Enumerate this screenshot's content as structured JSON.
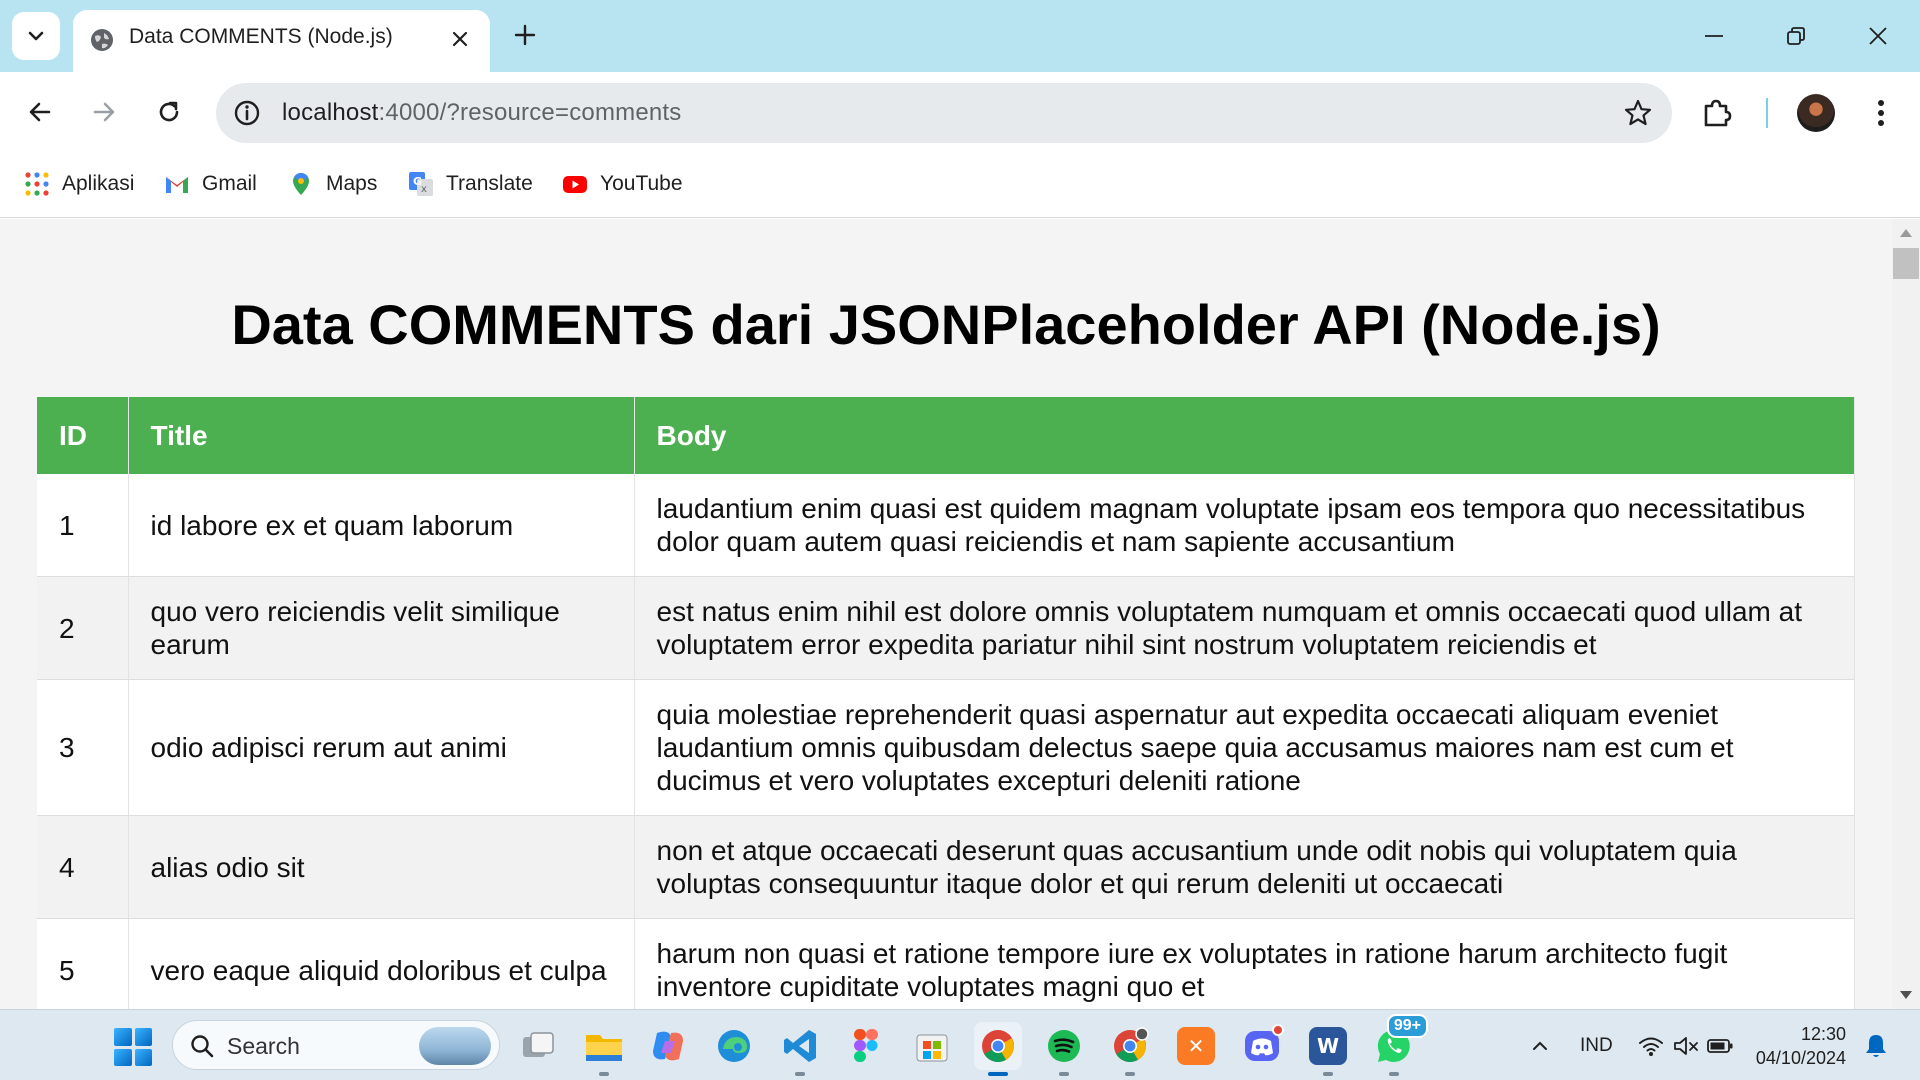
{
  "browser": {
    "tab": {
      "title": "Data COMMENTS (Node.js)"
    },
    "address": {
      "host": "localhost",
      "rest": ":4000/?resource=comments"
    },
    "bookmarks": [
      {
        "label": "Aplikasi",
        "icon": "apps-grid-icon"
      },
      {
        "label": "Gmail",
        "icon": "gmail-icon"
      },
      {
        "label": "Maps",
        "icon": "maps-icon"
      },
      {
        "label": "Translate",
        "icon": "translate-icon"
      },
      {
        "label": "YouTube",
        "icon": "youtube-icon"
      }
    ]
  },
  "page": {
    "heading": "Data COMMENTS dari JSONPlaceholder API (Node.js)",
    "table": {
      "headers": [
        "ID",
        "Title",
        "Body"
      ],
      "rows": [
        {
          "id": "1",
          "title": "id labore ex et quam laborum",
          "body": "laudantium enim quasi est quidem magnam voluptate ipsam eos tempora quo necessitatibus dolor quam autem quasi reiciendis et nam sapiente accusantium"
        },
        {
          "id": "2",
          "title": "quo vero reiciendis velit similique earum",
          "body": "est natus enim nihil est dolore omnis voluptatem numquam et omnis occaecati quod ullam at voluptatem error expedita pariatur nihil sint nostrum voluptatem reiciendis et"
        },
        {
          "id": "3",
          "title": "odio adipisci rerum aut animi",
          "body": "quia molestiae reprehenderit quasi aspernatur aut expedita occaecati aliquam eveniet laudantium omnis quibusdam delectus saepe quia accusamus maiores nam est cum et ducimus et vero voluptates excepturi deleniti ratione"
        },
        {
          "id": "4",
          "title": "alias odio sit",
          "body": "non et atque occaecati deserunt quas accusantium unde odit nobis qui voluptatem quia voluptas consequuntur itaque dolor et qui rerum deleniti ut occaecati"
        },
        {
          "id": "5",
          "title": "vero eaque aliquid doloribus et culpa",
          "body": "harum non quasi et ratione tempore iure ex voluptates in ratione harum architecto fugit inventore cupiditate voluptates magni quo et"
        }
      ]
    },
    "colors": {
      "header_bg": "#4caf50",
      "header_text": "#ffffff",
      "stripe": "#f2f2f2"
    }
  },
  "taskbar": {
    "search_label": "Search",
    "whatsapp_badge": "99+",
    "language": "IND",
    "time": "12:30",
    "date": "04/10/2024"
  }
}
